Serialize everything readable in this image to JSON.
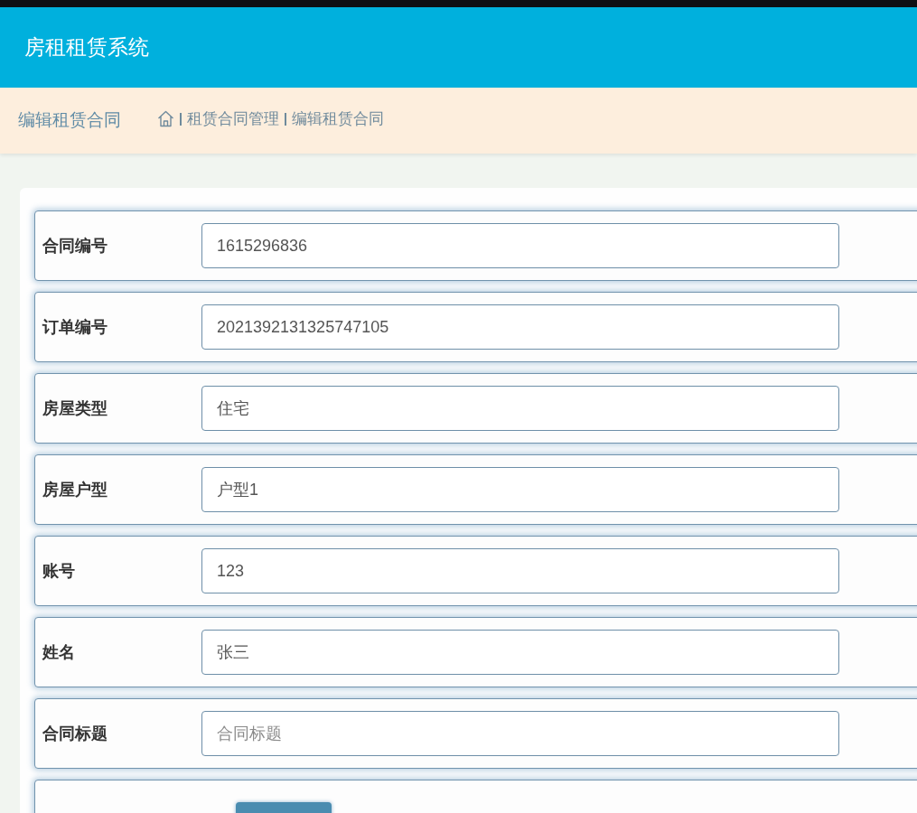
{
  "header": {
    "title": "房租租赁系统"
  },
  "breadcrumb_bar": {
    "page_title": "编辑租赁合同",
    "trail": [
      "租赁合同管理",
      "编辑租赁合同"
    ]
  },
  "form": {
    "fields": [
      {
        "label": "合同编号",
        "value": "1615296836"
      },
      {
        "label": "订单编号",
        "value": "2021392131325747105"
      },
      {
        "label": "房屋类型",
        "value": "住宅"
      },
      {
        "label": "房屋户型",
        "value": "户型1"
      },
      {
        "label": "账号",
        "value": "123"
      },
      {
        "label": "姓名",
        "value": "张三"
      },
      {
        "label": "合同标题",
        "placeholder": "合同标题"
      }
    ]
  }
}
